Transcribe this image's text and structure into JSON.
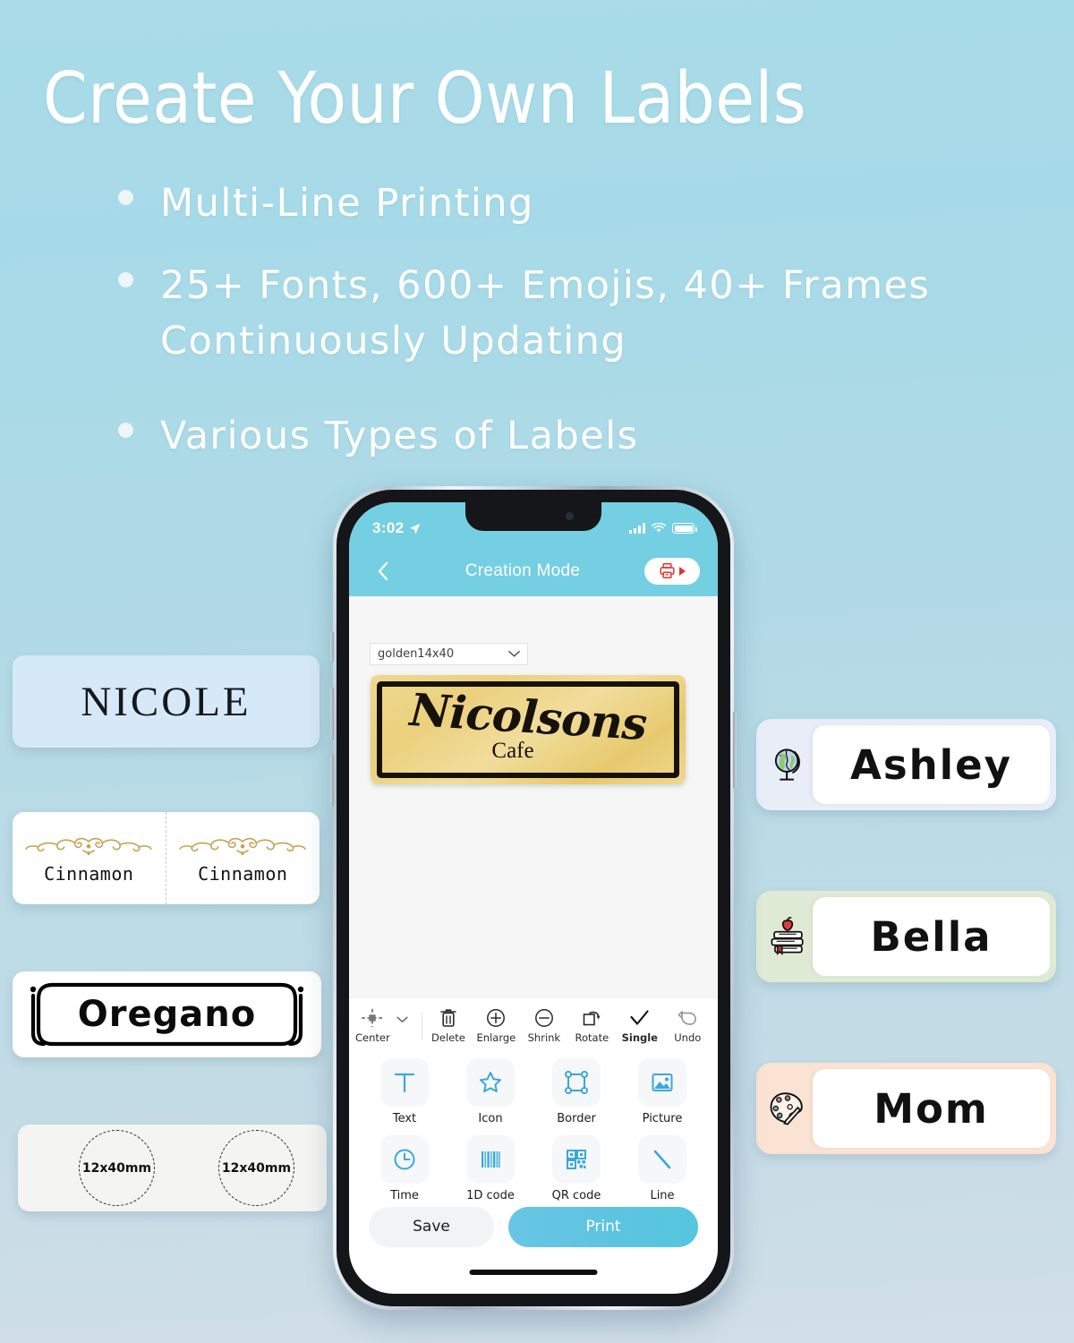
{
  "hero": {
    "title": "Create Your Own Labels",
    "bullets": [
      "Multi-Line Printing",
      "25+ Fonts, 600+ Emojis, 40+ Frames Continuously Updating",
      "Various Types of Labels"
    ]
  },
  "samples": {
    "nicole": {
      "text": "NICOLE",
      "bg": "#d6e9f8"
    },
    "cinnamon": {
      "left_text": "Cinnamon",
      "right_text": "Cinnamon",
      "ornament_color": "#c6a455"
    },
    "oregano": {
      "text": "Oregano"
    },
    "circles": {
      "left_text": "12x40mm",
      "right_text": "12x40mm"
    }
  },
  "nametags": [
    {
      "name": "Ashley",
      "icon": "globe-icon",
      "glyph": "🌍",
      "bg": "#e9edf8"
    },
    {
      "name": "Bella",
      "icon": "books-apple-icon",
      "glyph": "📚",
      "bg": "#dfead4"
    },
    {
      "name": "Mom",
      "icon": "palette-icon",
      "glyph": "🎨",
      "bg": "#fae3d2"
    }
  ],
  "phone": {
    "status": {
      "time": "3:02",
      "location_icon": "location-arrow-icon",
      "signal_icon": "cellular-signal-icon",
      "wifi_icon": "wifi-icon",
      "battery_icon": "battery-icon"
    },
    "header": {
      "back_icon": "back-chevron-icon",
      "title": "Creation Mode",
      "print_icon": "printer-icon",
      "print_arrow_icon": "play-triangle-icon"
    },
    "canvas": {
      "size_value": "golden14x40",
      "size_chevron_icon": "chevron-down-icon",
      "label_script": "Nicolsons",
      "label_sub": "Cafe"
    },
    "toolbar": [
      {
        "label": "Center",
        "icon": "align-center-icon"
      },
      {
        "label": "Delete",
        "icon": "trash-icon"
      },
      {
        "label": "Enlarge",
        "icon": "plus-circle-icon"
      },
      {
        "label": "Shrink",
        "icon": "minus-circle-icon"
      },
      {
        "label": "Rotate",
        "icon": "rotate-icon"
      },
      {
        "label": "Single",
        "icon": "check-icon"
      },
      {
        "label": "Undo",
        "icon": "undo-arrow-icon"
      }
    ],
    "tools": [
      {
        "label": "Text",
        "icon": "text-t-icon"
      },
      {
        "label": "Icon",
        "icon": "star-icon"
      },
      {
        "label": "Border",
        "icon": "border-frame-icon"
      },
      {
        "label": "Picture",
        "icon": "image-icon"
      },
      {
        "label": "Time",
        "icon": "clock-icon"
      },
      {
        "label": "1D code",
        "icon": "barcode-icon"
      },
      {
        "label": "QR code",
        "icon": "qr-code-icon"
      },
      {
        "label": "Line",
        "icon": "diagonal-line-icon"
      }
    ],
    "actions": {
      "save_label": "Save",
      "print_label": "Print"
    },
    "accent": "#5ec4e2",
    "header_bg": "#74cfe3"
  }
}
